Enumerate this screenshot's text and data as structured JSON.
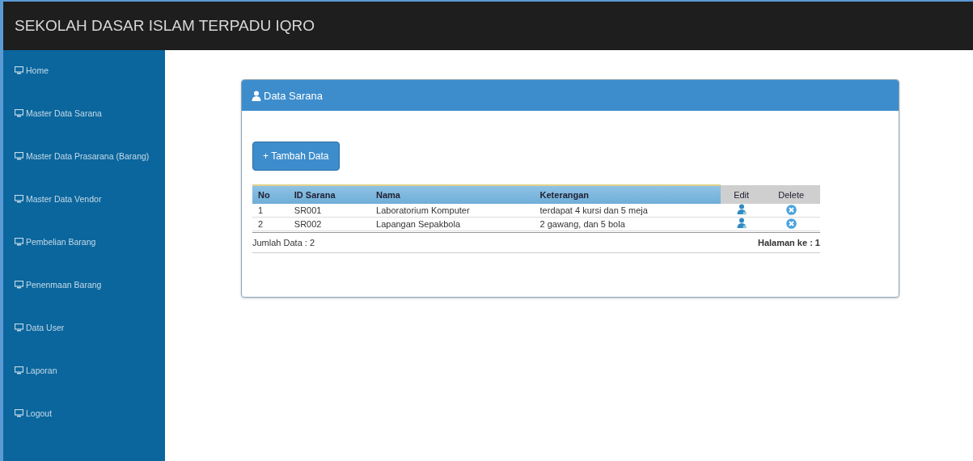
{
  "header": {
    "title": "SEKOLAH DASAR ISLAM TERPADU IQRO"
  },
  "sidebar": {
    "items": [
      {
        "label": "Home"
      },
      {
        "label": "Master Data Sarana"
      },
      {
        "label": "Master Data Prasarana (Barang)"
      },
      {
        "label": "Master Data Vendor"
      },
      {
        "label": "Pembelian Barang"
      },
      {
        "label": "Penenmaan Barang"
      },
      {
        "label": "Data User"
      },
      {
        "label": "Laporan"
      },
      {
        "label": "Logout"
      }
    ]
  },
  "panel": {
    "title": "Data Sarana",
    "add_button": "+ Tambah Data",
    "table": {
      "columns": [
        "No",
        "ID Sarana",
        "Nama",
        "Keterangan",
        "Edit",
        "Delete"
      ],
      "rows": [
        {
          "no": "1",
          "id": "SR001",
          "nama": "Laboratorium Komputer",
          "keterangan": "terdapat 4 kursi dan 5 meja"
        },
        {
          "no": "2",
          "id": "SR002",
          "nama": "Lapangan Sepakbola",
          "keterangan": "2 gawang, dan 5 bola"
        }
      ]
    },
    "footer_left": "Jumlah Data : 2",
    "footer_right": "Halaman ke : 1"
  }
}
